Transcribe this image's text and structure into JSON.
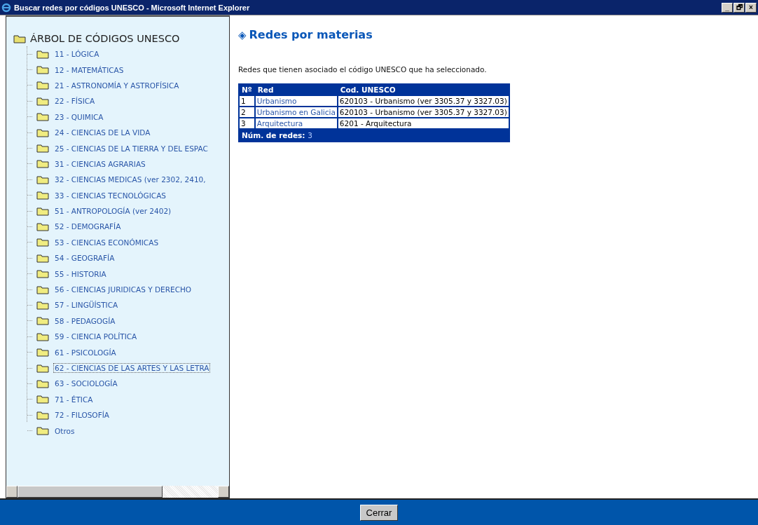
{
  "window": {
    "title": "Buscar redes por códigos UNESCO - Microsoft Internet Explorer",
    "controls": [
      "_",
      "🗗",
      "×"
    ]
  },
  "tree": {
    "title": "ÁRBOL DE CÓDIGOS UNESCO",
    "items": [
      {
        "label": "11 - LÓGICA",
        "selected": false
      },
      {
        "label": "12 - MATEMÁTICAS",
        "selected": false
      },
      {
        "label": "21 - ASTRONOMÍA Y ASTROFÍSICA",
        "selected": false
      },
      {
        "label": "22 - FÍSICA",
        "selected": false
      },
      {
        "label": "23 - QUIMICA",
        "selected": false
      },
      {
        "label": "24 - CIENCIAS DE LA VIDA",
        "selected": false
      },
      {
        "label": "25 - CIENCIAS DE LA TIERRA Y DEL ESPAC",
        "selected": false
      },
      {
        "label": "31 - CIENCIAS AGRARIAS",
        "selected": false
      },
      {
        "label": "32 - CIENCIAS MEDICAS (ver 2302, 2410,",
        "selected": false
      },
      {
        "label": "33 - CIENCIAS TECNOLÓGICAS",
        "selected": false
      },
      {
        "label": "51 - ANTROPOLOGÍA (ver 2402)",
        "selected": false
      },
      {
        "label": "52 - DEMOGRAFÍA",
        "selected": false
      },
      {
        "label": "53 - CIENCIAS ECONÓMICAS",
        "selected": false
      },
      {
        "label": "54 - GEOGRAFÍA",
        "selected": false
      },
      {
        "label": "55 - HISTORIA",
        "selected": false
      },
      {
        "label": "56 - CIENCIAS JURIDICAS Y DERECHO",
        "selected": false
      },
      {
        "label": "57 - LINGÜÍSTICA",
        "selected": false
      },
      {
        "label": "58 - PEDAGOGÍA",
        "selected": false
      },
      {
        "label": "59 - CIENCIA POLÍTICA",
        "selected": false
      },
      {
        "label": "61 - PSICOLOGÍA",
        "selected": false
      },
      {
        "label": "62 - CIENCIAS DE LAS ARTES Y LAS LETRA",
        "selected": true
      },
      {
        "label": "63 - SOCIOLOGÍA",
        "selected": false
      },
      {
        "label": "71 - ÉTICA",
        "selected": false
      },
      {
        "label": "72 - FILOSOFÍA",
        "selected": false
      },
      {
        "label": "Otros",
        "selected": false
      }
    ]
  },
  "content": {
    "heading_icon": "◈",
    "heading": "Redes por materias",
    "description": "Redes que tienen asociado el código UNESCO que ha seleccionado.",
    "table": {
      "columns": [
        "Nº",
        "Red",
        "Cod. UNESCO"
      ],
      "rows": [
        {
          "n": "1",
          "red": "Urbanismo",
          "code": "620103 -  Urbanismo (ver 3305.37 y 3327.03)"
        },
        {
          "n": "2",
          "red": "Urbanismo en Galicia",
          "code": "620103 -  Urbanismo (ver 3305.37 y 3327.03)"
        },
        {
          "n": "3",
          "red": "Arquitectura",
          "code": "6201 -  Arquitectura"
        }
      ],
      "footer_label": "Núm. de redes:",
      "footer_value": "3"
    }
  },
  "footer": {
    "button": "Cerrar"
  }
}
